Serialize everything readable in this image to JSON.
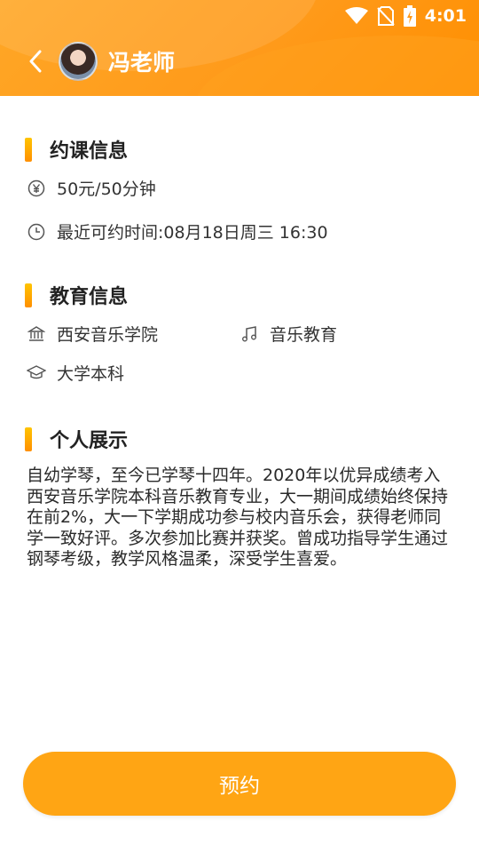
{
  "status_bar": {
    "time": "4:01",
    "icons": [
      "wifi-icon",
      "no-sim-icon",
      "battery-charging-icon"
    ]
  },
  "header": {
    "back_icon": "chevron-left-icon",
    "avatar": "teacher-avatar",
    "title": "冯老师"
  },
  "booking_info": {
    "title": "约课信息",
    "price_icon": "yuan-icon",
    "price": "50元/50分钟",
    "time_icon": "clock-icon",
    "next_available": "最近可约时间:08月18日周三 16:30"
  },
  "education_info": {
    "title": "教育信息",
    "school_icon": "university-icon",
    "school": "西安音乐学院",
    "major_icon": "music-note-icon",
    "major": "音乐教育",
    "degree_icon": "graduation-cap-icon",
    "degree": "大学本科"
  },
  "profile": {
    "title": "个人展示",
    "bio": "自幼学琴，至今已学琴十四年。2020年以优异成绩考入西安音乐学院本科音乐教育专业，大一期间成绩始终保持在前2%，大一下学期成功参与校内音乐会，获得老师同学一致好评。多次参加比赛并获奖。曾成功指导学生通过钢琴考级，教学风格温柔，深受学生喜爱。"
  },
  "actions": {
    "book_label": "预约"
  },
  "colors": {
    "accent": "#ffa514",
    "header": "#ff9a1a"
  }
}
